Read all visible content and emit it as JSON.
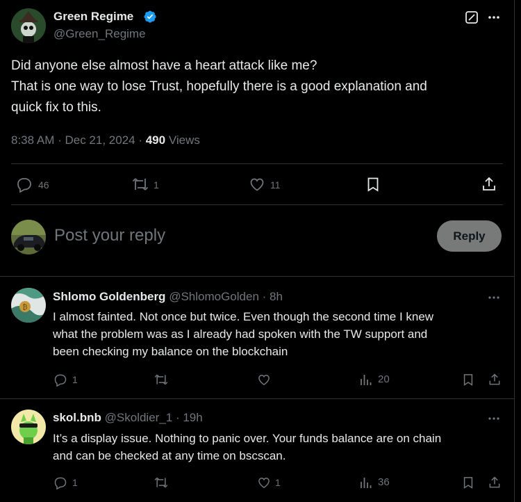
{
  "tweet": {
    "author_name": "Green Regime",
    "author_handle": "@Green_Regime",
    "text_line1": "Did anyone else almost have a heart attack like me?",
    "text_line2": "That is one way to lose Trust, hopefully there is a good explanation and",
    "text_line3": "quick fix to this.",
    "time": "8:38 AM · Dec 21, 2024 · ",
    "views_count": "490",
    "views_label": " Views",
    "replies": "46",
    "reposts": "1",
    "likes": "11"
  },
  "compose": {
    "placeholder": "Post your reply",
    "button": "Reply"
  },
  "replies": [
    {
      "name": "Shlomo Goldenberg",
      "handle": "@ShlomoGolden · 8h",
      "line1": "I almost fainted. Not once but twice. Even though the second time I knew",
      "line2": "what the problem was as I already had spoken with the TW support and",
      "line3": "been checking my balance on the blockchain",
      "replies": "1",
      "reposts": "",
      "likes": "",
      "views": "20"
    },
    {
      "name": "skol.bnb",
      "handle": "@Skoldier_1 · 19h",
      "line1": "It’s a display issue. Nothing to panic over. Your funds balance are on chain",
      "line2": "and can be checked at any time on bscscan.",
      "replies": "1",
      "reposts": "",
      "likes": "1",
      "views": "36"
    }
  ],
  "colors": {
    "background": "#000000",
    "text": "#e7e9ea",
    "secondary": "#71767b",
    "divider": "#2f3336",
    "verified": "#1d9bf0",
    "reply_button": "#787a7a"
  }
}
